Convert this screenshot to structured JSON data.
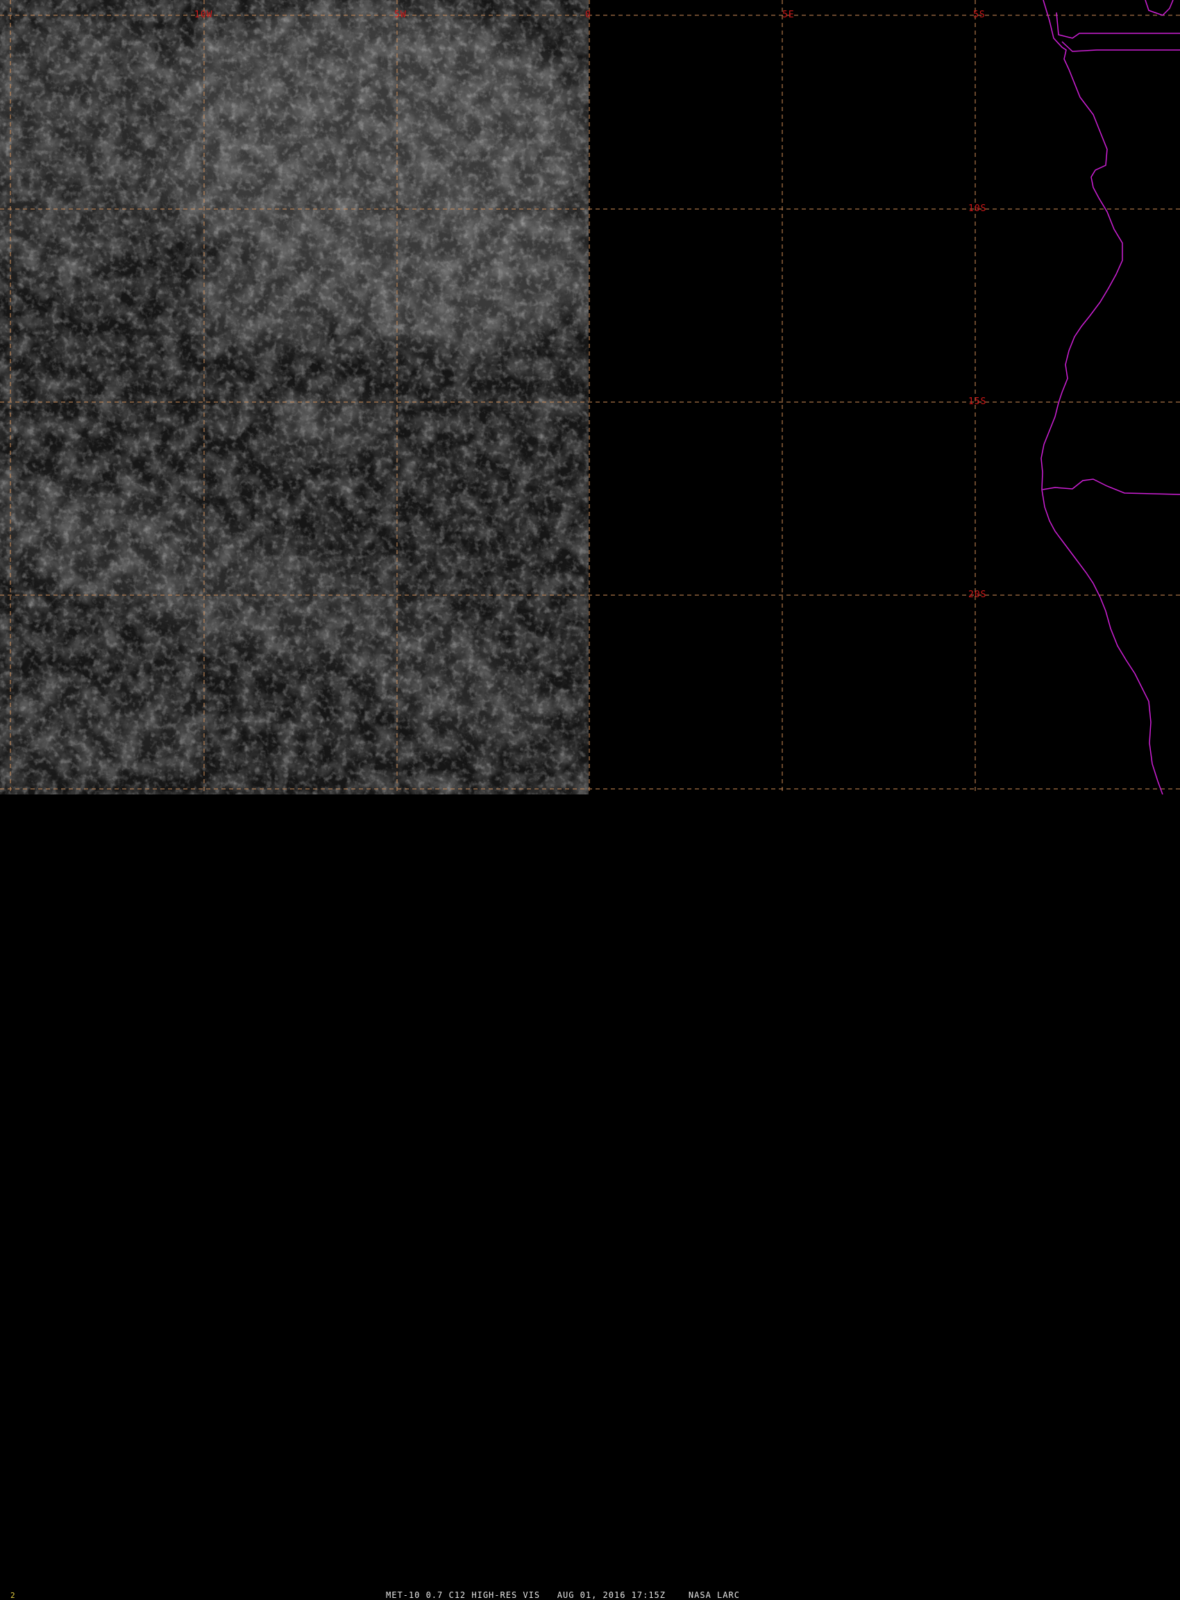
{
  "imagery": {
    "satellite": "MET-10",
    "channel": "0.7 C12 HIGH-RES VIS"
  },
  "grid": {
    "longitude_labels": [
      "10W",
      "5W",
      "0",
      "5E"
    ],
    "latitude_labels": [
      "5S",
      "10S",
      "15S",
      "20S"
    ],
    "line_color": "#d49058",
    "label_color": "#d01818"
  },
  "coastline_color": "#d020d8",
  "caption": {
    "frame_number": "2",
    "text": "MET-10 0.7 C12 HIGH-RES VIS   AUG 01, 2016 17:15Z    NASA LARC"
  }
}
